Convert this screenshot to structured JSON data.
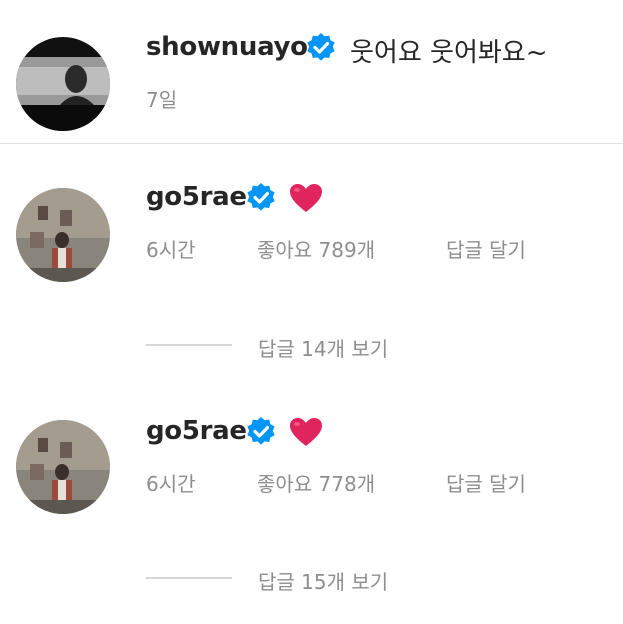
{
  "caption": {
    "username": "shownuayo",
    "text": "웃어요 웃어봐요~",
    "time": "7일"
  },
  "comments": [
    {
      "username": "go5rae",
      "emoji": "❤️",
      "time": "6시간",
      "likes": "좋아요 789개",
      "reply_label": "답글 달기",
      "view_replies": "답글 14개 보기"
    },
    {
      "username": "go5rae",
      "emoji": "❤️",
      "time": "6시간",
      "likes": "좋아요 778개",
      "reply_label": "답글 달기",
      "view_replies": "답글 15개 보기"
    }
  ],
  "colors": {
    "verified_badge": "#0095f6",
    "heart": "#e0245e",
    "muted_text": "#8e8e8e",
    "primary_text": "#262626"
  }
}
